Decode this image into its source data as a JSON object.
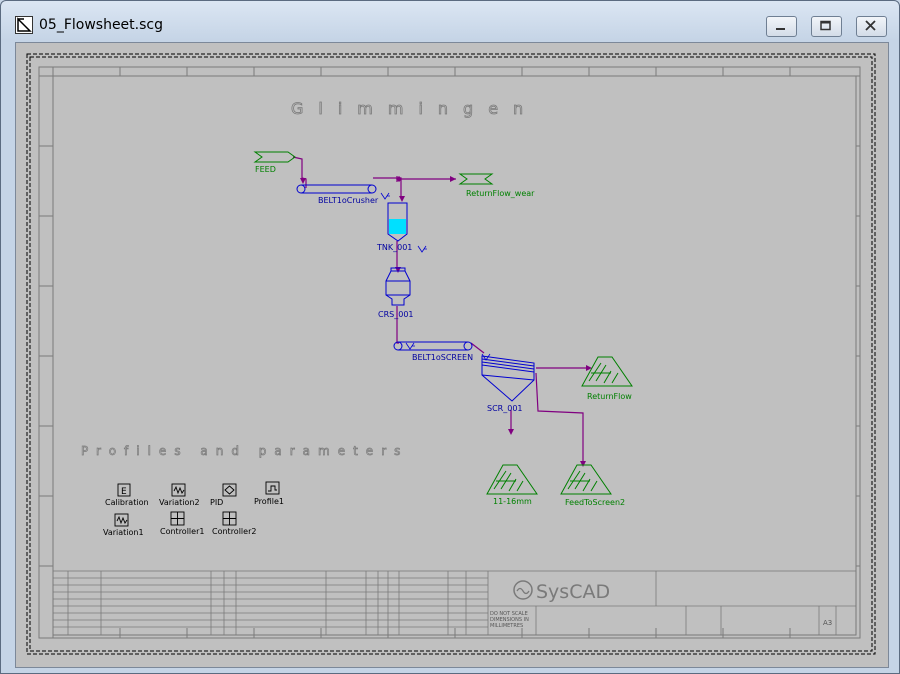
{
  "window": {
    "title": "05_Flowsheet.scg"
  },
  "sheet": {
    "heading": "Glimmingen",
    "section_title": "Profiles and parameters",
    "logo_text": "SysCAD"
  },
  "units": {
    "feed": "FEED",
    "belt_crusher": "BELT1oCrusher",
    "return_wear": "ReturnFlow_wear",
    "tank": "TNK_001",
    "crusher": "CRS_001",
    "belt_screen": "BELT1oSCREEN",
    "screen": "SCR_001",
    "return_flow": "ReturnFlow",
    "product_11_16": "11-16mm",
    "feed_to_screen2": "FeedToScreen2"
  },
  "params": [
    {
      "id": "calibration",
      "label": "Calibration",
      "icon": "E"
    },
    {
      "id": "variation2",
      "label": "Variation2",
      "icon": "wave"
    },
    {
      "id": "pid",
      "label": "PID",
      "icon": "diamond"
    },
    {
      "id": "profile1",
      "label": "Profile1",
      "icon": "step"
    },
    {
      "id": "variation1",
      "label": "Variation1",
      "icon": "wave"
    },
    {
      "id": "controller1",
      "label": "Controller1",
      "icon": "grid"
    },
    {
      "id": "controller2",
      "label": "Controller2",
      "icon": "grid"
    }
  ],
  "titleblock": {
    "do_not_scale": "DO NOT SCALE",
    "dims_line": "DIMENSIONS IN",
    "mm_line": "MILLIMETRES",
    "sheet_size": "A3"
  },
  "colors": {
    "stream": "#800080",
    "unit": "#0000d0",
    "label": "#0000a0",
    "feedgreen": "#008000",
    "tankfill": "#00e0ff",
    "border": "#808080"
  }
}
